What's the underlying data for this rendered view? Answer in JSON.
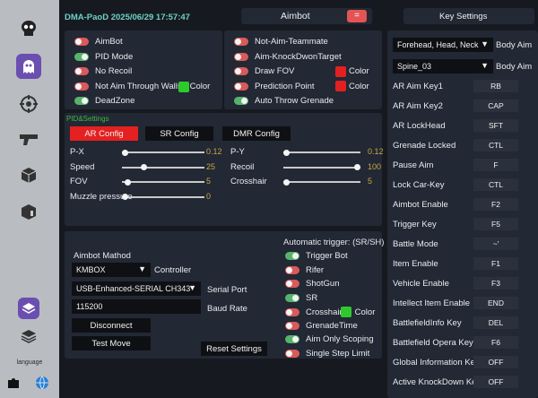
{
  "header": {
    "title": "DMA-PaoD 2025/06/29 17:57:47",
    "aimbot_tab": "Aimbot",
    "menu_icon": "=",
    "key_settings_tab": "Key Settings"
  },
  "sidebar": {
    "language_label": "language",
    "icons": [
      "skull-icon",
      "ghost-icon",
      "crosshair-eye-icon",
      "pistol-icon",
      "box-icon",
      "box-alt-icon",
      "layers-icon",
      "stack-icon",
      "puzzle-icon",
      "globe-icon"
    ]
  },
  "aim_toggles": [
    {
      "label": "AimBot",
      "state": "on"
    },
    {
      "label": "PID Mode",
      "state": "off"
    },
    {
      "label": "No Recoil",
      "state": "on"
    },
    {
      "label": "Not Aim Through Walls",
      "state": "on"
    },
    {
      "label": "DeadZone",
      "state": "off"
    }
  ],
  "aim_color_label": "Color",
  "aim_color_value": "#2dc92d",
  "misc_toggles": [
    {
      "label": "Not-Aim-Teammate",
      "state": "on"
    },
    {
      "label": "Aim-KnockDwonTarget",
      "state": "on"
    },
    {
      "label": "Draw FOV",
      "state": "on",
      "color": "#e22020"
    },
    {
      "label": "Prediction Point",
      "state": "on",
      "color": "#e22020"
    },
    {
      "label": "Auto Throw Grenade",
      "state": "off"
    }
  ],
  "misc_color_label": "Color",
  "pid": {
    "title": "PID&Settings",
    "tabs": [
      "AR Config",
      "SR Config",
      "DMR Config"
    ],
    "active_tab": 0,
    "sliders_left": [
      {
        "label": "P-X",
        "value": "0.12",
        "fraction": 0.0
      },
      {
        "label": "Speed",
        "value": "25",
        "fraction": 0.25
      },
      {
        "label": "FOV",
        "value": "5",
        "fraction": 0.04
      },
      {
        "label": "Muzzle pressure",
        "value": "0",
        "fraction": 0.0
      }
    ],
    "sliders_right": [
      {
        "label": "P-Y",
        "value": "0.12",
        "fraction": 0.0
      },
      {
        "label": "Recoil",
        "value": "100",
        "fraction": 1.0
      },
      {
        "label": "Crosshair",
        "value": "5",
        "fraction": 0.0
      }
    ]
  },
  "aimbot_method": {
    "title": "Aimbot Mathod",
    "controller_value": "KMBOX",
    "controller_label": "Controller",
    "serial_value": "USB-Enhanced-SERIAL CH343",
    "serial_label": "Serial Port",
    "baud_value": "115200",
    "baud_label": "Baud Rate",
    "disconnect": "Disconnect",
    "test_move": "Test Move",
    "reset": "Reset Settings"
  },
  "trigger": {
    "title": "Automatic trigger: (SR/SH)",
    "items": [
      {
        "label": "Trigger Bot",
        "state": "off"
      },
      {
        "label": "Rifer",
        "state": "on"
      },
      {
        "label": "ShotGun",
        "state": "on"
      },
      {
        "label": "SR",
        "state": "off"
      },
      {
        "label": "Crosshair",
        "state": "on"
      },
      {
        "label": "GrenadeTime",
        "state": "on"
      },
      {
        "label": "Aim Only Scoping",
        "state": "off"
      },
      {
        "label": "Single Step Limit",
        "state": "on"
      }
    ],
    "color_label": "Color",
    "color_value": "#2dc92d"
  },
  "key_settings": {
    "aim_parts": [
      {
        "value": "Forehead, Head, Neck",
        "label": "Body Aim"
      },
      {
        "value": "Spine_03",
        "label": "Body Aim"
      }
    ],
    "keys": [
      {
        "label": "AR Aim Key1",
        "key": "RB"
      },
      {
        "label": "AR Aim Key2",
        "key": "CAP"
      },
      {
        "label": "AR LockHead",
        "key": "SFT"
      },
      {
        "label": "Grenade Locked",
        "key": "CTL"
      },
      {
        "label": "Pause Aim",
        "key": "F"
      },
      {
        "label": "Lock Car-Key",
        "key": "CTL"
      },
      {
        "label": "Aimbot Enable",
        "key": "F2"
      },
      {
        "label": "Trigger Key",
        "key": "F5"
      },
      {
        "label": "Battle Mode",
        "key": "~'"
      },
      {
        "label": "Item Enable",
        "key": "F1"
      },
      {
        "label": "Vehicle Enable",
        "key": "F3"
      },
      {
        "label": "Intellect Item Enable",
        "key": "END"
      },
      {
        "label": "BattlefieldInfo Key",
        "key": "DEL"
      },
      {
        "label": "Battlefield Opera Key",
        "key": "F6"
      },
      {
        "label": "Global Information Key",
        "key": "OFF"
      },
      {
        "label": "Active KnockDown Key",
        "key": "OFF"
      }
    ]
  }
}
